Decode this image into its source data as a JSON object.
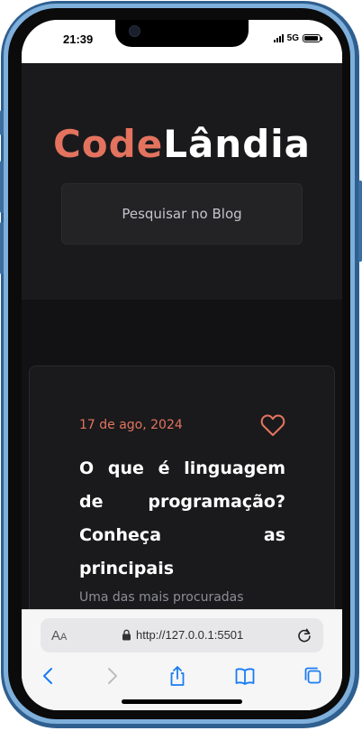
{
  "status_bar": {
    "time": "21:39",
    "network": "5G"
  },
  "site": {
    "logo_part1": "Code",
    "logo_part2": "Lândia",
    "search_placeholder": "Pesquisar no Blog"
  },
  "post": {
    "date": "17 de ago, 2024",
    "title": "O que é linguagem de programação? Conheça as principais",
    "excerpt": "Uma das mais procuradas"
  },
  "browser": {
    "text_size_label_big": "A",
    "text_size_label_small": "A",
    "url": "http://127.0.0.1:5501"
  },
  "colors": {
    "accent": "#e3735e",
    "ios_blue": "#1a7cf2"
  }
}
